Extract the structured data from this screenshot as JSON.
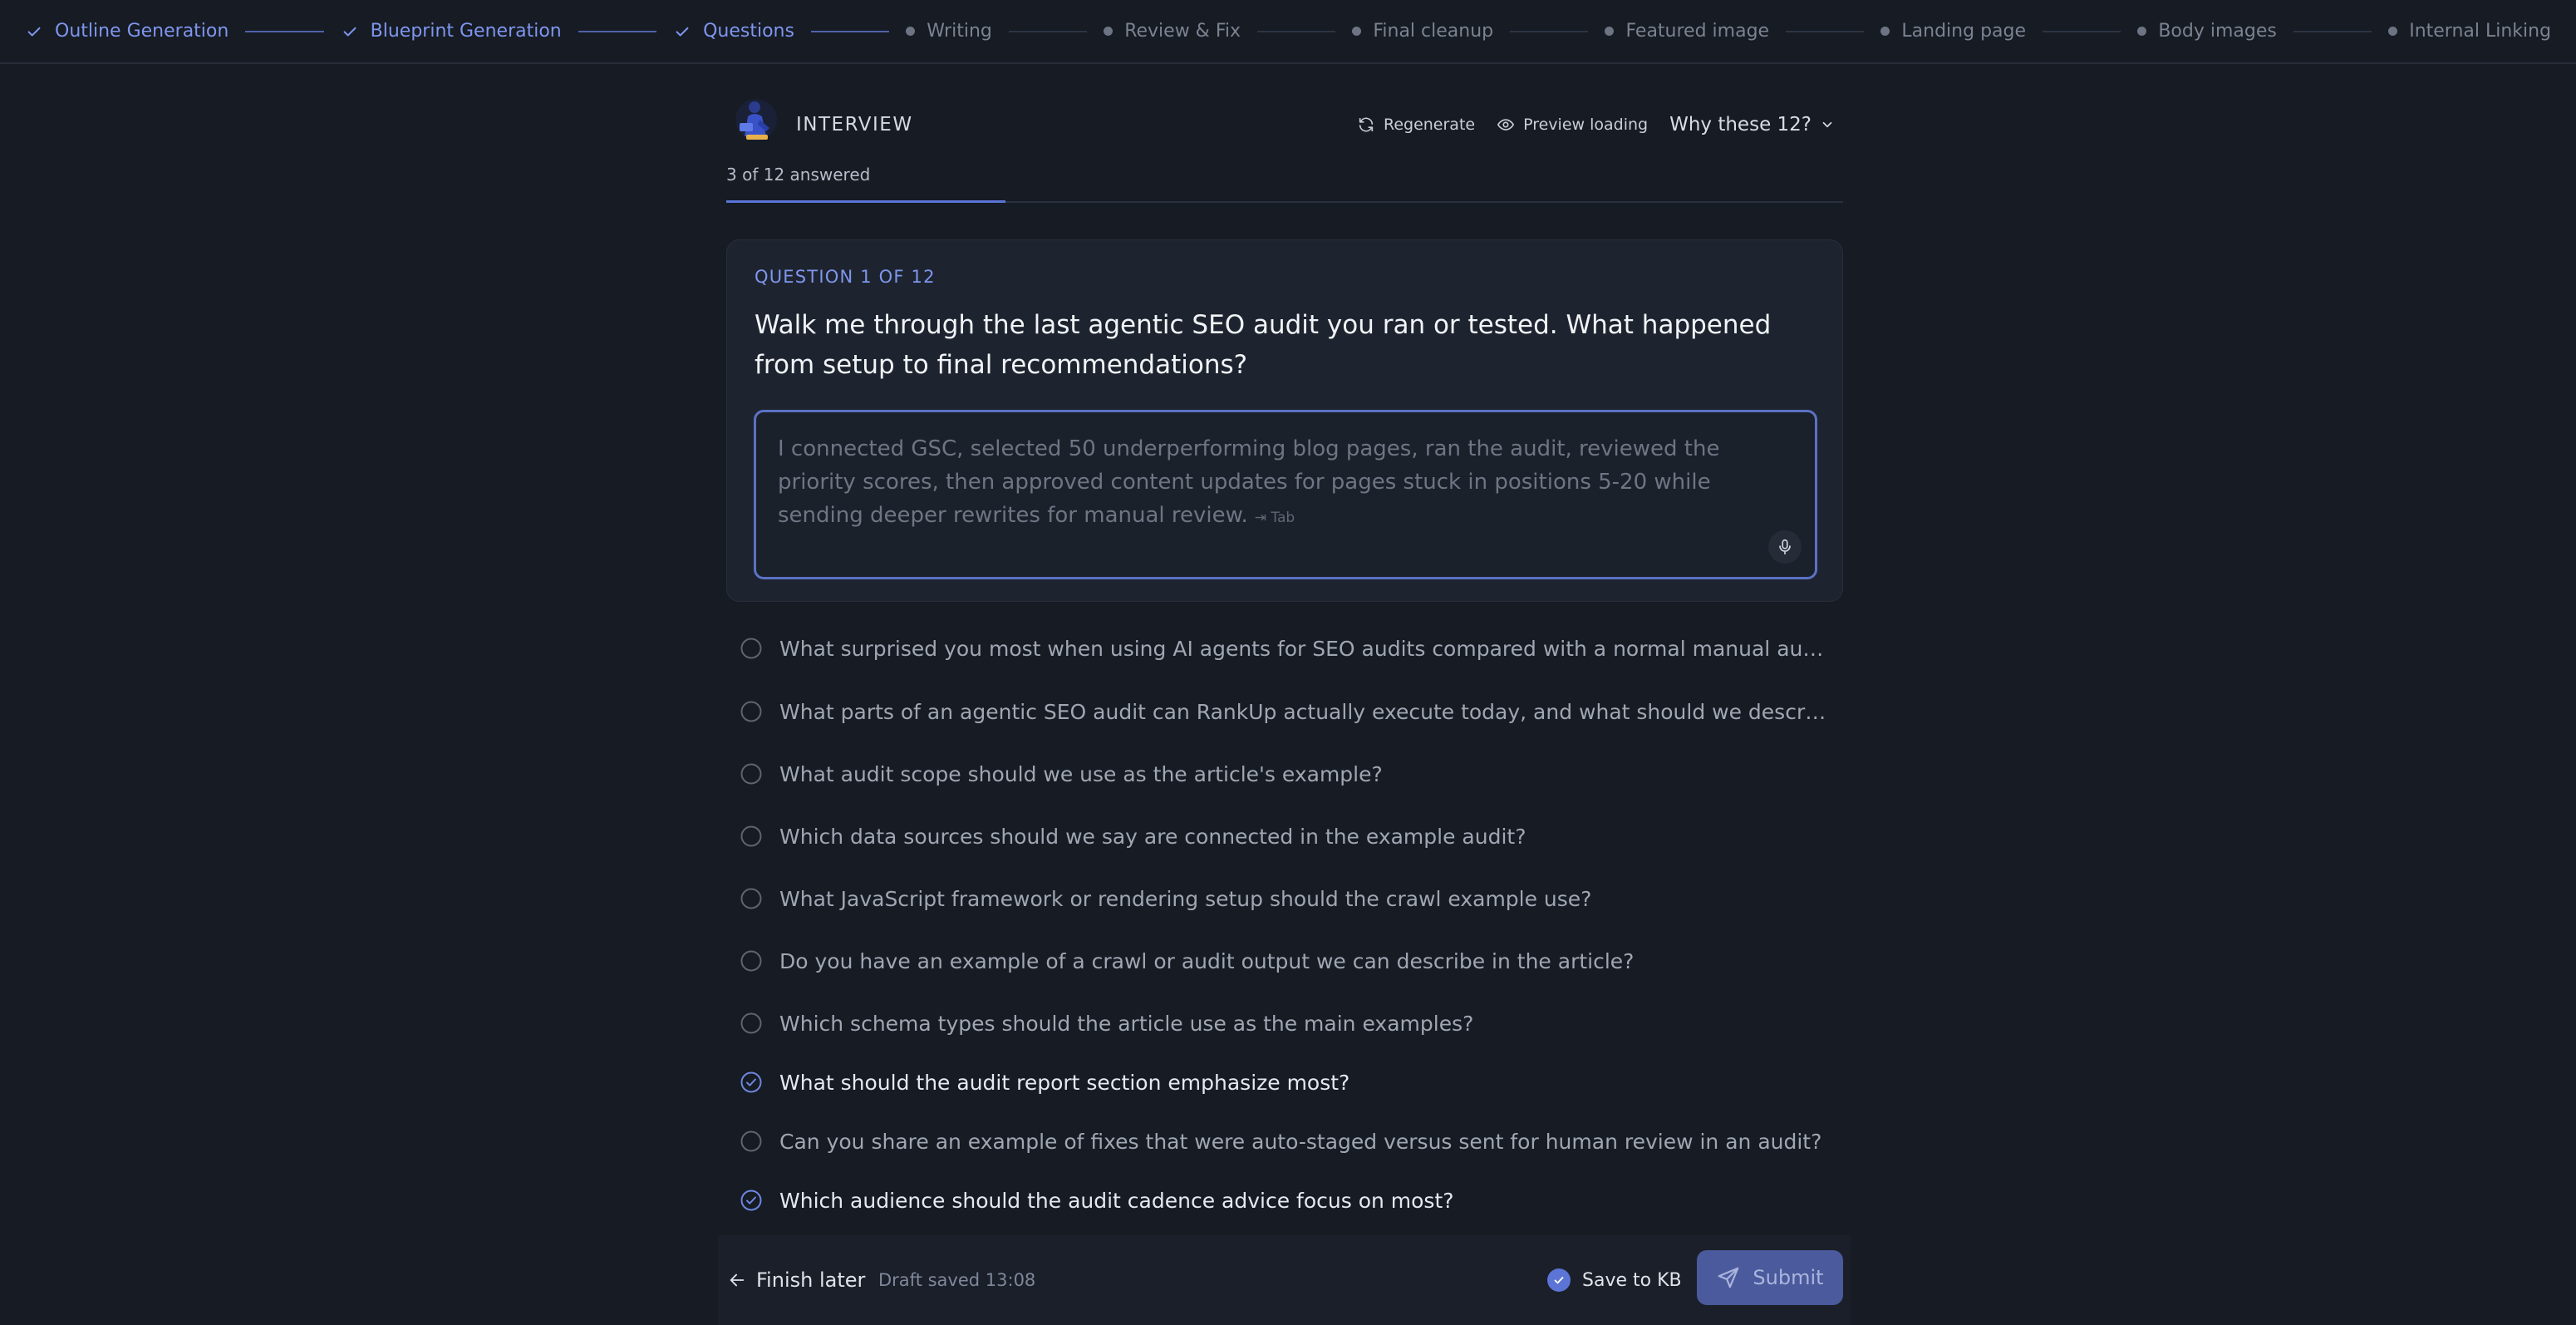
{
  "stepper": {
    "steps": [
      {
        "label": "Outline Generation",
        "state": "done"
      },
      {
        "label": "Blueprint Generation",
        "state": "done"
      },
      {
        "label": "Questions",
        "state": "done"
      },
      {
        "label": "Writing",
        "state": "todo"
      },
      {
        "label": "Review & Fix",
        "state": "todo"
      },
      {
        "label": "Final cleanup",
        "state": "todo"
      },
      {
        "label": "Featured image",
        "state": "todo"
      },
      {
        "label": "Landing page",
        "state": "todo"
      },
      {
        "label": "Body images",
        "state": "todo"
      },
      {
        "label": "Internal Linking",
        "state": "todo"
      }
    ]
  },
  "header": {
    "title": "INTERVIEW",
    "regenerate_label": "Regenerate",
    "preview_label": "Preview loading",
    "why_label": "Why these 12?"
  },
  "progress": {
    "label": "3 of 12 answered",
    "answered": 3,
    "total": 12
  },
  "current_question": {
    "kicker": "QUESTION 1 OF 12",
    "text": "Walk me through the last agentic SEO audit you ran or tested. What happened from setup to final recommendations?",
    "placeholder": "I connected GSC, selected 50 underperforming blog pages, ran the audit, reviewed the priority scores, then approved content updates for pages stuck in positions 5-20 while sending deeper rewrites for manual review.",
    "tab_hint": "⇥ Tab"
  },
  "questions": [
    {
      "text": "What surprised you most when using AI agents for SEO audits compared with a normal manual audit?",
      "answered": false
    },
    {
      "text": "What parts of an agentic SEO audit can RankUp actually execute today, and what should we describe as…",
      "answered": false
    },
    {
      "text": "What audit scope should we use as the article's example?",
      "answered": false
    },
    {
      "text": "Which data sources should we say are connected in the example audit?",
      "answered": false
    },
    {
      "text": "What JavaScript framework or rendering setup should the crawl example use?",
      "answered": false
    },
    {
      "text": "Do you have an example of a crawl or audit output we can describe in the article?",
      "answered": false
    },
    {
      "text": "Which schema types should the article use as the main examples?",
      "answered": false
    },
    {
      "text": "What should the audit report section emphasize most?",
      "answered": true
    },
    {
      "text": "Can you share an example of fixes that were auto-staged versus sent for human review in an audit?",
      "answered": false
    },
    {
      "text": "Which audience should the audit cadence advice focus on most?",
      "answered": true
    }
  ],
  "footer": {
    "finish_label": "Finish later",
    "draft_status": "Draft saved 13:08",
    "save_kb_label": "Save to KB",
    "save_kb_checked": true,
    "submit_label": "Submit"
  },
  "colors": {
    "accent": "#7f96ee",
    "accent_strong": "#5b74d6",
    "background": "#161b24",
    "card": "#1e242f"
  }
}
